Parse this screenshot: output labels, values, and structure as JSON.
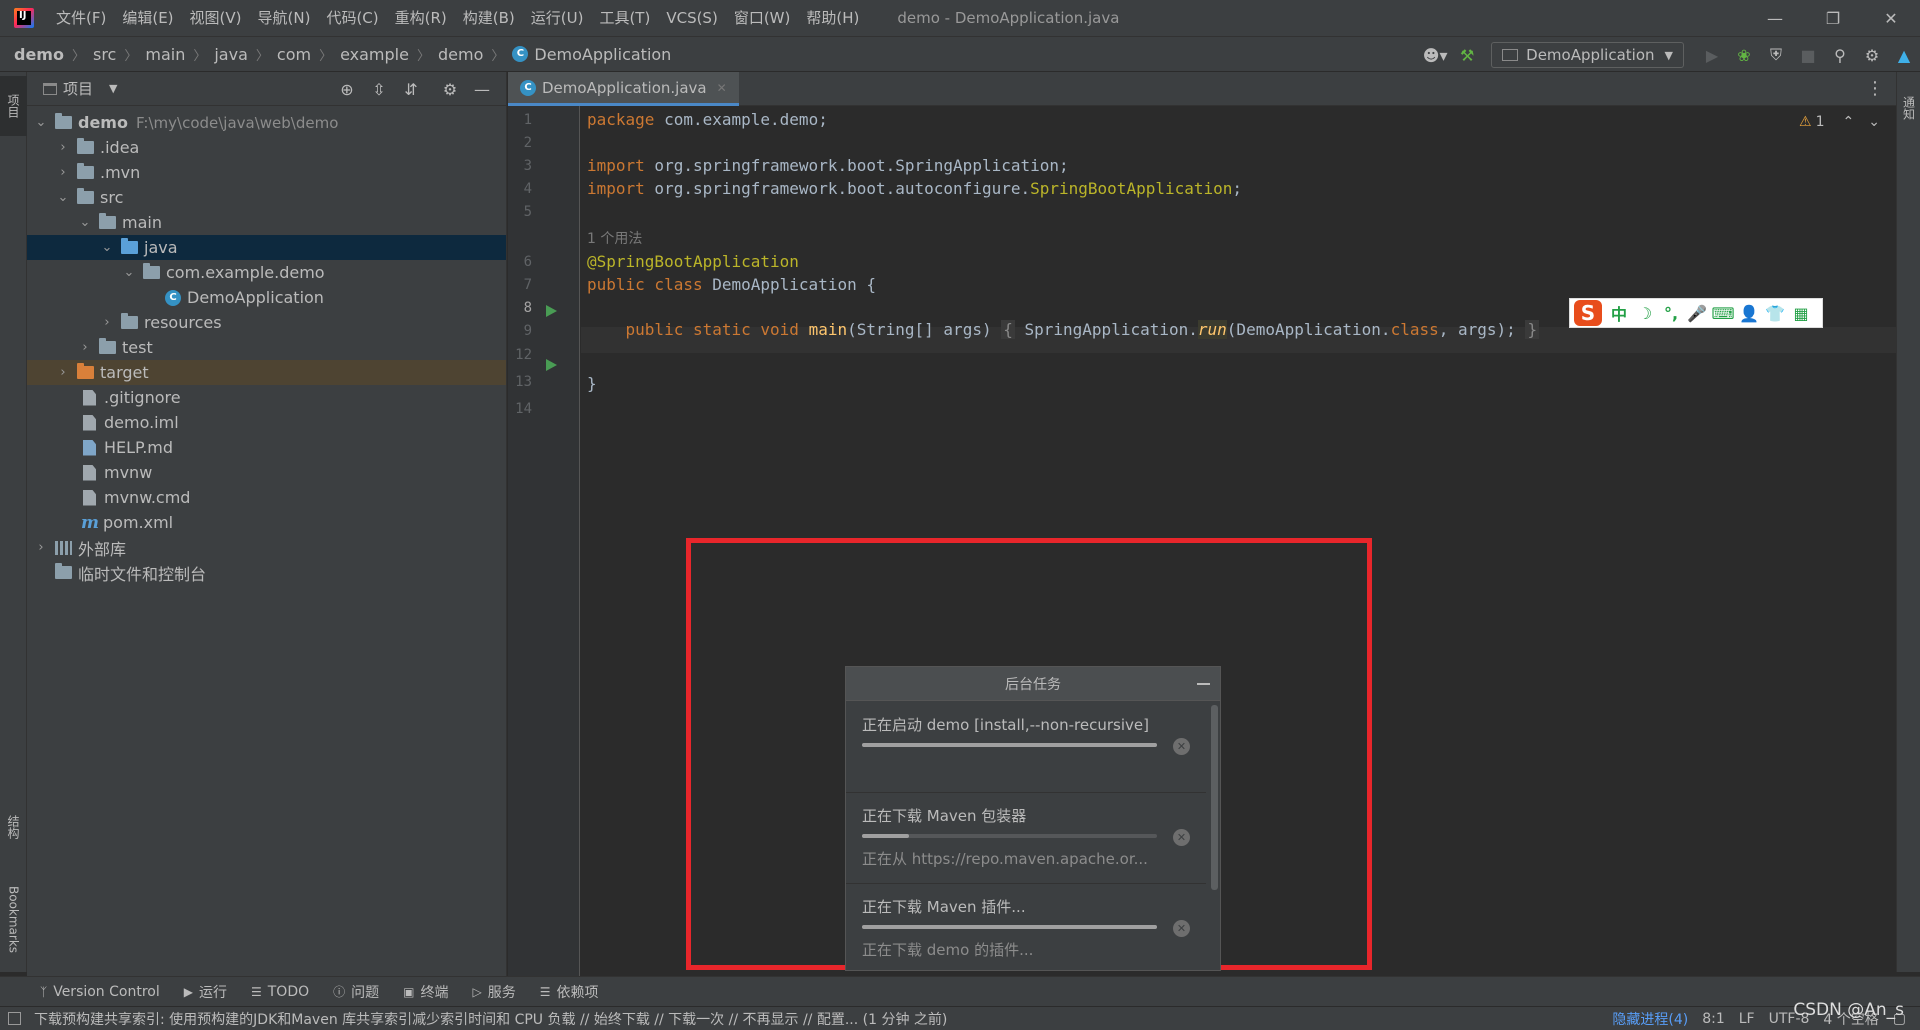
{
  "window": {
    "title": "demo - DemoApplication.java"
  },
  "menu": [
    "文件(F)",
    "编辑(E)",
    "视图(V)",
    "导航(N)",
    "代码(C)",
    "重构(R)",
    "构建(B)",
    "运行(U)",
    "工具(T)",
    "VCS(S)",
    "窗口(W)",
    "帮助(H)"
  ],
  "breadcrumb": [
    "demo",
    "src",
    "main",
    "java",
    "com",
    "example",
    "demo",
    "DemoApplication"
  ],
  "run_config": "DemoApplication",
  "left_stripe": {
    "project": "项目",
    "structure": "结构",
    "bookmarks": "Bookmarks"
  },
  "right_stripe": {
    "notifications": "通知"
  },
  "project_panel": {
    "title": "项目",
    "tree": [
      {
        "label": "demo",
        "hint": "F:\\my\\code\\java\\web\\demo"
      },
      {
        "label": ".idea"
      },
      {
        "label": ".mvn"
      },
      {
        "label": "src"
      },
      {
        "label": "main"
      },
      {
        "label": "java"
      },
      {
        "label": "com.example.demo"
      },
      {
        "label": "DemoApplication"
      },
      {
        "label": "resources"
      },
      {
        "label": "test"
      },
      {
        "label": "target"
      },
      {
        "label": ".gitignore"
      },
      {
        "label": "demo.iml"
      },
      {
        "label": "HELP.md"
      },
      {
        "label": "mvnw"
      },
      {
        "label": "mvnw.cmd"
      },
      {
        "label": "pom.xml"
      },
      {
        "label": "外部库"
      },
      {
        "label": "临时文件和控制台"
      }
    ]
  },
  "editor": {
    "tab": "DemoApplication.java",
    "inspection_count": "1",
    "line_numbers": [
      "1",
      "2",
      "3",
      "4",
      "5",
      "6",
      "7",
      "8",
      "9",
      "12",
      "13",
      "14"
    ],
    "usage_hint": "1 个用法",
    "code": {
      "l1_kw": "package",
      "l1_rest": " com.example.demo;",
      "l3_kw": "import",
      "l3_rest": " org.springframework.boot.SpringApplication;",
      "l4_kw": "import",
      "l4_rest": " org.springframework.boot.autoconfigure.",
      "l4_ann": "SpringBootApplication",
      "l4_end": ";",
      "l6_ann": "@SpringBootApplication",
      "l7_kw": "public class",
      "l7_rest": " DemoApplication {",
      "l9_kw": "public static void",
      "l9_fn": "main",
      "l9_args": "(String[] args) ",
      "l9_open": "{",
      "l9_call": " SpringApplication.",
      "l9_run": "run",
      "l9_params": "(DemoApplication.",
      "l9_class": "class",
      "l9_tail": ", args); ",
      "l9_close": "}",
      "l13": "}"
    }
  },
  "ime": {
    "logo": "S",
    "items": [
      "中",
      "☽",
      "°,",
      "🎤",
      "⌨",
      "👤",
      "👕",
      "▦"
    ]
  },
  "background_tasks": {
    "title": "后台任务",
    "tasks": [
      {
        "name": "正在启动 demo [install,--non-recursive]",
        "progress": 1.0,
        "detail": ""
      },
      {
        "name": "正在下载 Maven 包装器",
        "progress": 0.16,
        "detail": "正在从 https://repo.maven.apache.or..."
      },
      {
        "name": "正在下载 Maven 插件...",
        "progress": 1.0,
        "detail": "正在下载 demo 的插件..."
      }
    ]
  },
  "bottom_tools": [
    "Version Control",
    "运行",
    "TODO",
    "问题",
    "终端",
    "服务",
    "依赖项"
  ],
  "status": {
    "message": "下载预构建共享索引: 使用预构建的JDK和Maven 库共享索引减少索引时间和 CPU 负载 // 始终下载 // 下载一次 // 不再显示 // 配置... (1 分钟 之前)",
    "hidden_processes": "隐藏进程(4)",
    "position": "8:1",
    "line_sep": "LF",
    "encoding": "UTF-8",
    "indent": "4 个空格"
  },
  "watermark": "CSDN @An_s",
  "colors": {
    "highlight": "#e8262b",
    "keyword": "#cc7832",
    "annotation": "#bbb529",
    "accent": "#4a88c7"
  }
}
